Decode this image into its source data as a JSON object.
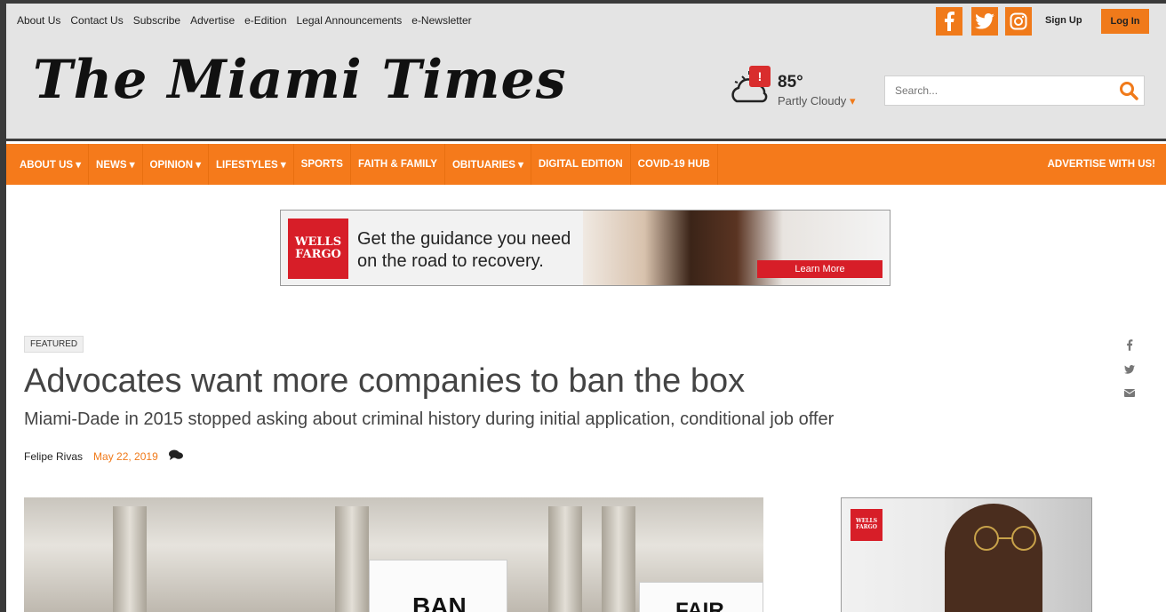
{
  "top_links": [
    "About Us",
    "Contact Us",
    "Subscribe",
    "Advertise",
    "e-Edition",
    "Legal Announcements",
    "e-Newsletter"
  ],
  "account": {
    "sign_up": "Sign Up",
    "log_in": "Log In"
  },
  "social_icons": [
    "facebook-icon",
    "twitter-icon",
    "instagram-icon"
  ],
  "logo_text": "The Miami Times",
  "weather": {
    "temp": "85°",
    "condition": "Partly Cloudy",
    "caret": "▾",
    "alert": "!"
  },
  "search": {
    "placeholder": "Search..."
  },
  "nav": {
    "items": [
      "ABOUT US ▾",
      "NEWS ▾",
      "OPINION ▾",
      "LIFESTYLES ▾",
      "SPORTS",
      "FAITH & FAMILY",
      "OBITUARIES ▾",
      "DIGITAL EDITION",
      "COVID-19 HUB"
    ],
    "advertise": "ADVERTISE WITH US!"
  },
  "banner_ad": {
    "brand_line1": "WELLS",
    "brand_line2": "FARGO",
    "text_line1": "Get the guidance you need",
    "text_line2": "on the road to recovery.",
    "cta": "Learn More"
  },
  "article": {
    "tag": "FEATURED",
    "headline": "Advocates want more companies to ban the box",
    "subheadline": "Miami-Dade in 2015 stopped asking about criminal history during initial application, conditional job offer",
    "author": "Felipe Rivas",
    "date": "May 22, 2019"
  },
  "photo_signs": [
    "BAN",
    "FAIR"
  ],
  "side_ad": {
    "brand_line1": "WELLS",
    "brand_line2": "FARGO"
  },
  "colors": {
    "accent": "#f57a1b",
    "brand_red": "#d71e28",
    "header_bg": "#e4e4e4"
  }
}
